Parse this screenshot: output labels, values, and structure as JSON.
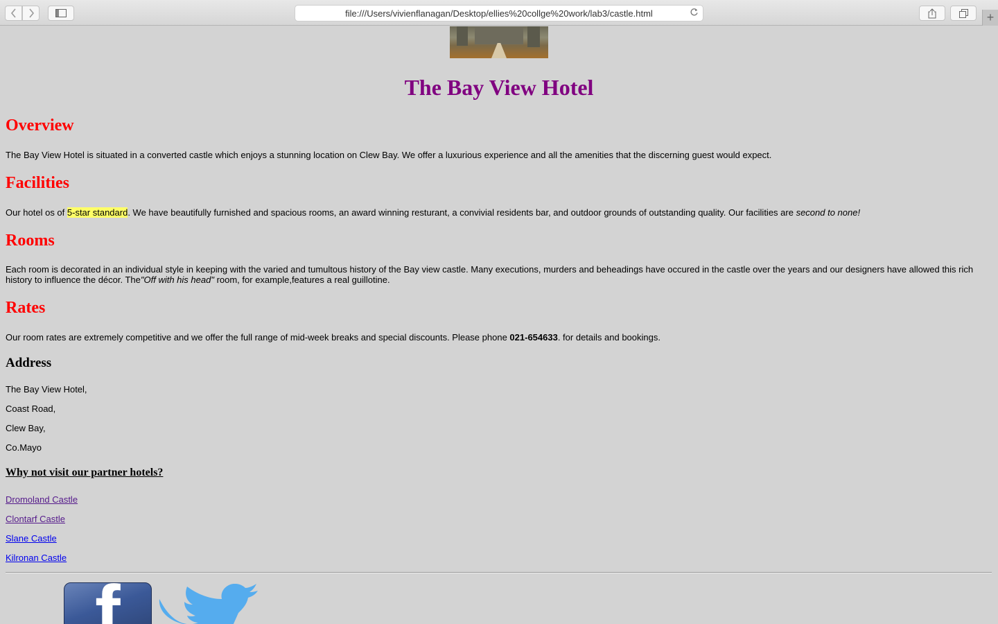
{
  "browser": {
    "url": "file:///Users/vivienflanagan/Desktop/ellies%20collge%20work/lab3/castle.html",
    "icons": [
      "chevron-left-icon",
      "chevron-right-icon",
      "sidebar-icon",
      "reload-icon",
      "share-icon",
      "tabs-icon",
      "plus-icon"
    ]
  },
  "page": {
    "title": "The Bay View Hotel",
    "overview": {
      "heading": "Overview",
      "text": "The Bay View Hotel is situated in a converted castle which enjoys a stunning location on Clew Bay. We offer a luxurious experience and all the amenities that the discerning guest would expect."
    },
    "facilities": {
      "heading": "Facilities",
      "text_before": "Our hotel os of ",
      "highlight": "5-star standard",
      "text_after": ". We have beautifully furnished and spacious rooms, an award winning resturant, a convivial residents bar, and outdoor grounds of outstanding quality. Our facilities are ",
      "emphasis": "second to none!"
    },
    "rooms": {
      "heading": "Rooms",
      "text_before": "Each room is decorated in an individual style in keeping with the varied and tumultous history of the Bay view castle. Many executions, murders and beheadings have occured in the castle over the years and our designers have allowed this rich history to influence the décor. The",
      "emphasis": "\"Off with his head\"",
      "text_after": " room, for example,features a real guillotine."
    },
    "rates": {
      "heading": "Rates",
      "text_before": "Our room rates are extremely competitive and we offer the full range of mid-week breaks and special discounts. Please phone ",
      "phone": "021-654633",
      "text_after": ". for details and bookings."
    },
    "address": {
      "heading": "Address",
      "lines": [
        "The Bay View Hotel,",
        "Coast Road,",
        "Clew Bay,",
        "Co.Mayo"
      ]
    },
    "partners": {
      "heading": "Why not visit our partner hotels?",
      "links": [
        "Dromoland Castle",
        "Clontarf Castle",
        "Slane Castle",
        "Kilronan Castle"
      ]
    },
    "social": {
      "facebook_letter": "f",
      "icons": [
        "facebook-icon",
        "twitter-icon"
      ]
    },
    "colors": {
      "background": "#d3d3d3",
      "title": "#800080",
      "section_heading": "#ff0000",
      "highlight": "#ffff66",
      "visited_link": "#551a8b",
      "link": "#0000ee",
      "twitter": "#55acee",
      "facebook": "#3b5998"
    }
  }
}
